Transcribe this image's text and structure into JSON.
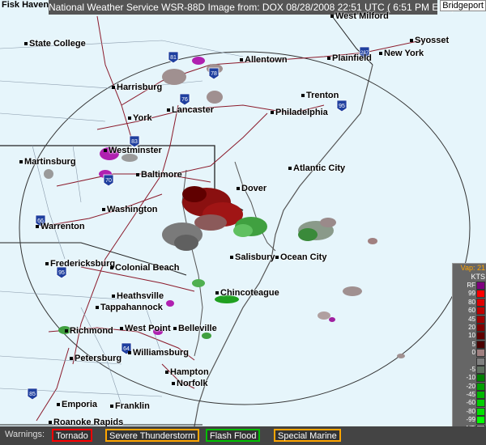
{
  "header": {
    "title": "National Weather Service WSR-88D Image from: DOX 08/28/2008 22:51 UTC ( 6:51 PM EDT)"
  },
  "corner_labels": {
    "top_left": "Fisk Haven",
    "top_right": "Bridgeport"
  },
  "cities": [
    {
      "id": "state-college",
      "name": "State College"
    },
    {
      "id": "allentown",
      "name": "Allentown"
    },
    {
      "id": "plainfield",
      "name": "Plainfield"
    },
    {
      "id": "new-york",
      "name": "New York"
    },
    {
      "id": "syosset",
      "name": "Syosset"
    },
    {
      "id": "west-milford",
      "name": "West Milford"
    },
    {
      "id": "harrisburg",
      "name": "Harrisburg"
    },
    {
      "id": "lancaster",
      "name": "Lancaster"
    },
    {
      "id": "trenton",
      "name": "Trenton"
    },
    {
      "id": "philadelphia",
      "name": "Philadelphia"
    },
    {
      "id": "york",
      "name": "York"
    },
    {
      "id": "westminster",
      "name": "Westminster"
    },
    {
      "id": "martinsburg",
      "name": "Martinsburg"
    },
    {
      "id": "baltimore",
      "name": "Baltimore"
    },
    {
      "id": "atlantic-city",
      "name": "Atlantic City"
    },
    {
      "id": "dover",
      "name": "Dover"
    },
    {
      "id": "washington",
      "name": "Washington"
    },
    {
      "id": "warrenton",
      "name": "Warrenton"
    },
    {
      "id": "salisbury",
      "name": "Salisbury"
    },
    {
      "id": "ocean-city",
      "name": "Ocean City"
    },
    {
      "id": "fredericksburg",
      "name": "Fredericksburg"
    },
    {
      "id": "colonial-beach",
      "name": "Colonial Beach"
    },
    {
      "id": "heathsville",
      "name": "Heathsville"
    },
    {
      "id": "tappahannock",
      "name": "Tappahannock"
    },
    {
      "id": "chincoteague",
      "name": "Chincoteague"
    },
    {
      "id": "richmond",
      "name": "Richmond"
    },
    {
      "id": "west-point",
      "name": "West Point"
    },
    {
      "id": "belleville",
      "name": "Belleville"
    },
    {
      "id": "williamsburg",
      "name": "Williamsburg"
    },
    {
      "id": "petersburg",
      "name": "Petersburg"
    },
    {
      "id": "hampton",
      "name": "Hampton"
    },
    {
      "id": "norfolk",
      "name": "Norfolk"
    },
    {
      "id": "emporia",
      "name": "Emporia"
    },
    {
      "id": "franklin",
      "name": "Franklin"
    },
    {
      "id": "roanoke-rapids",
      "name": "Roanoke Rapids"
    }
  ],
  "interstates": [
    "81",
    "78",
    "76",
    "287",
    "95",
    "83",
    "70",
    "66",
    "95",
    "64",
    "85"
  ],
  "legend": {
    "title": "Vap: 21",
    "units": "KTS",
    "entries": [
      {
        "label": "RF",
        "color": "#7f007f"
      },
      {
        "label": "99",
        "color": "#ff0000"
      },
      {
        "label": "80",
        "color": "#e00000"
      },
      {
        "label": "60",
        "color": "#c00000"
      },
      {
        "label": "45",
        "color": "#a00000"
      },
      {
        "label": "20",
        "color": "#800000"
      },
      {
        "label": "10",
        "color": "#600000"
      },
      {
        "label": "5",
        "color": "#4a0000"
      },
      {
        "label": "0",
        "color": "#a08080"
      },
      {
        "label": "",
        "color": "#808080"
      },
      {
        "label": "-5",
        "color": "#607060"
      },
      {
        "label": "-10",
        "color": "#008000"
      },
      {
        "label": "-20",
        "color": "#00a000"
      },
      {
        "label": "-45",
        "color": "#00b800"
      },
      {
        "label": "-60",
        "color": "#00d000"
      },
      {
        "label": "-80",
        "color": "#00e000"
      },
      {
        "label": "-99",
        "color": "#00ff00"
      },
      {
        "label": "ND",
        "color": "#c0c0c0"
      }
    ]
  },
  "warnings": {
    "label": "Warnings:",
    "items": [
      {
        "label": "Tornado",
        "color": "#ff0000"
      },
      {
        "label": "Severe Thunderstorm",
        "color": "#ffa500"
      },
      {
        "label": "Flash Flood",
        "color": "#00c000"
      },
      {
        "label": "Special Marine",
        "color": "#ffa500"
      }
    ]
  }
}
